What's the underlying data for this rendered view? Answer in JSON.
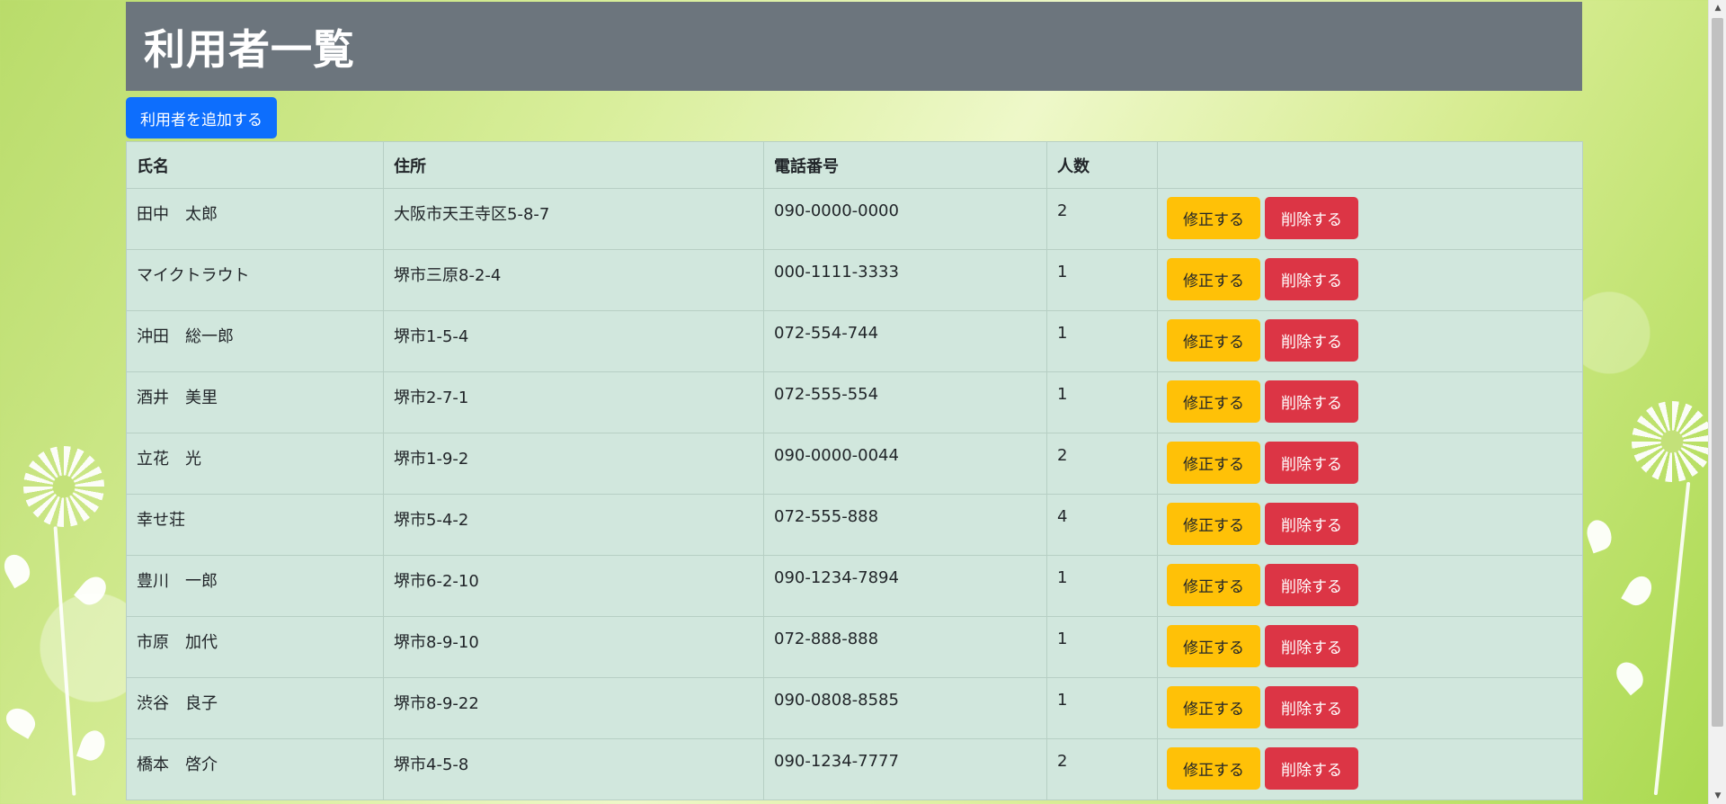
{
  "page": {
    "title": "利用者一覧"
  },
  "toolbar": {
    "add_label": "利用者を追加する"
  },
  "table": {
    "headers": [
      "氏名",
      "住所",
      "電話番号",
      "人数",
      ""
    ],
    "rows": [
      {
        "name": "田中　太郎",
        "address": "大阪市天王寺区5-8-7",
        "phone": "090-0000-0000",
        "count": "2"
      },
      {
        "name": "マイクトラウト",
        "address": "堺市三原8-2-4",
        "phone": "000-1111-3333",
        "count": "1"
      },
      {
        "name": "沖田　総一郎",
        "address": "堺市1-5-4",
        "phone": "072-554-744",
        "count": "1"
      },
      {
        "name": "酒井　美里",
        "address": "堺市2-7-1",
        "phone": "072-555-554",
        "count": "1"
      },
      {
        "name": "立花　光",
        "address": "堺市1-9-2",
        "phone": "090-0000-0044",
        "count": "2"
      },
      {
        "name": "幸せ荘",
        "address": "堺市5-4-2",
        "phone": "072-555-888",
        "count": "4"
      },
      {
        "name": "豊川　一郎",
        "address": "堺市6-2-10",
        "phone": "090-1234-7894",
        "count": "1"
      },
      {
        "name": "市原　加代",
        "address": "堺市8-9-10",
        "phone": "072-888-888",
        "count": "1"
      },
      {
        "name": "渋谷　良子",
        "address": "堺市8-9-22",
        "phone": "090-0808-8585",
        "count": "1"
      },
      {
        "name": "橋本　啓介",
        "address": "堺市4-5-8",
        "phone": "090-1234-7777",
        "count": "2"
      }
    ],
    "edit_label": "修正する",
    "delete_label": "削除する"
  },
  "colors": {
    "header_bg": "#6c757d",
    "primary": "#0d6efd",
    "warning": "#ffc107",
    "danger": "#dc3545",
    "table_bg": "#d1e7dd"
  },
  "icons": {
    "scroll_up": "scroll-up-arrow-icon",
    "scroll_down": "scroll-down-arrow-icon"
  }
}
